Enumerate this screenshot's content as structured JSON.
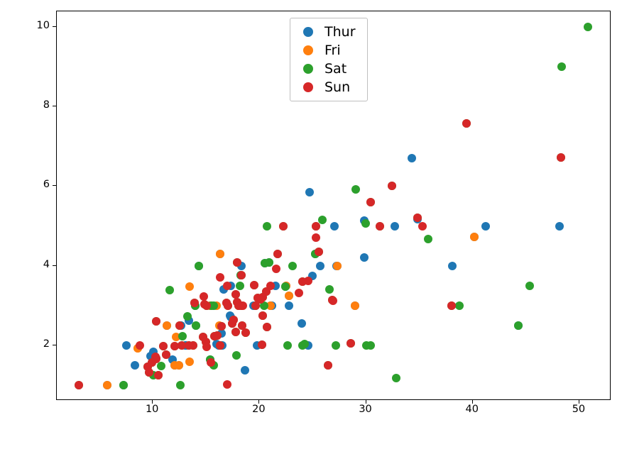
{
  "chart_data": {
    "type": "scatter",
    "title": "",
    "xlabel": "",
    "ylabel": "",
    "xlim": [
      1.0,
      53.0
    ],
    "ylim": [
      0.6,
      10.4
    ],
    "x_ticks": [
      10,
      20,
      30,
      40,
      50
    ],
    "y_ticks": [
      2,
      4,
      6,
      8,
      10
    ],
    "colors": {
      "Thur": "#1f77b4",
      "Fri": "#ff7f0e",
      "Sat": "#2ca02c",
      "Sun": "#d62728"
    },
    "legend": [
      "Thur",
      "Fri",
      "Sat",
      "Sun"
    ],
    "series": [
      {
        "name": "Thur",
        "points": [
          [
            27.2,
            4.0
          ],
          [
            22.76,
            3.0
          ],
          [
            17.29,
            2.71
          ],
          [
            19.44,
            3.0
          ],
          [
            16.66,
            3.4
          ],
          [
            10.07,
            1.83
          ],
          [
            32.68,
            5.0
          ],
          [
            15.98,
            2.03
          ],
          [
            34.83,
            5.17
          ],
          [
            13.03,
            2.0
          ],
          [
            18.28,
            4.0
          ],
          [
            24.71,
            5.85
          ],
          [
            21.16,
            3.0
          ],
          [
            28.97,
            3.0
          ],
          [
            22.49,
            3.5
          ],
          [
            5.75,
            1.0
          ],
          [
            16.32,
            4.3
          ],
          [
            22.75,
            3.25
          ],
          [
            40.17,
            4.73
          ],
          [
            27.28,
            4.0
          ],
          [
            12.03,
            1.5
          ],
          [
            21.01,
            3.0
          ],
          [
            12.46,
            1.5
          ],
          [
            11.35,
            2.5
          ],
          [
            15.38,
            3.0
          ],
          [
            44.3,
            2.5
          ],
          [
            22.42,
            3.48
          ],
          [
            20.92,
            4.08
          ],
          [
            15.36,
            1.64
          ],
          [
            20.49,
            4.06
          ],
          [
            25.21,
            4.29
          ],
          [
            18.24,
            3.76
          ],
          [
            14.31,
            4.0
          ],
          [
            14.0,
            3.0
          ],
          [
            7.25,
            1.0
          ],
          [
            38.07,
            4.0
          ],
          [
            23.95,
            2.55
          ],
          [
            25.71,
            4.0
          ],
          [
            17.31,
            3.5
          ],
          [
            29.8,
            4.2
          ],
          [
            34.3,
            6.7
          ],
          [
            41.19,
            5.0
          ],
          [
            27.05,
            5.0
          ],
          [
            16.43,
            2.3
          ],
          [
            8.35,
            1.5
          ],
          [
            18.64,
            1.36
          ],
          [
            11.87,
            1.63
          ],
          [
            9.78,
            1.73
          ],
          [
            7.51,
            2.0
          ],
          [
            14.07,
            2.5
          ],
          [
            13.13,
            2.0
          ],
          [
            17.26,
            2.74
          ],
          [
            24.55,
            2.0
          ],
          [
            19.77,
            2.0
          ],
          [
            29.85,
            5.14
          ],
          [
            48.17,
            5.0
          ],
          [
            25.0,
            3.75
          ],
          [
            13.39,
            2.61
          ],
          [
            16.49,
            2.0
          ],
          [
            21.5,
            3.5
          ],
          [
            12.66,
            2.5
          ],
          [
            16.21,
            2.0
          ]
        ]
      },
      {
        "name": "Fri",
        "points": [
          [
            28.97,
            3.0
          ],
          [
            22.49,
            3.5
          ],
          [
            5.75,
            1.0
          ],
          [
            16.32,
            4.3
          ],
          [
            22.75,
            3.25
          ],
          [
            40.17,
            4.73
          ],
          [
            27.28,
            4.0
          ],
          [
            12.03,
            1.5
          ],
          [
            21.01,
            3.0
          ],
          [
            12.46,
            1.5
          ],
          [
            11.35,
            2.5
          ],
          [
            15.38,
            3.0
          ],
          [
            8.58,
            1.92
          ],
          [
            13.42,
            1.58
          ],
          [
            12.16,
            2.2
          ],
          [
            13.42,
            3.48
          ],
          [
            8.58,
            1.92
          ],
          [
            15.98,
            3.0
          ],
          [
            16.27,
            2.5
          ]
        ]
      },
      {
        "name": "Sat",
        "points": [
          [
            20.65,
            3.35
          ],
          [
            17.92,
            4.08
          ],
          [
            20.29,
            2.75
          ],
          [
            15.77,
            2.23
          ],
          [
            39.42,
            7.58
          ],
          [
            19.82,
            3.18
          ],
          [
            17.81,
            2.34
          ],
          [
            13.37,
            2.0
          ],
          [
            12.69,
            2.0
          ],
          [
            21.7,
            4.3
          ],
          [
            19.65,
            3.0
          ],
          [
            9.55,
            1.45
          ],
          [
            18.35,
            2.5
          ],
          [
            15.06,
            3.0
          ],
          [
            20.69,
            2.45
          ],
          [
            17.78,
            3.27
          ],
          [
            24.06,
            3.6
          ],
          [
            16.31,
            2.0
          ],
          [
            16.93,
            3.07
          ],
          [
            18.69,
            2.31
          ],
          [
            31.27,
            5.0
          ],
          [
            16.04,
            2.24
          ],
          [
            17.46,
            2.54
          ],
          [
            13.94,
            3.06
          ],
          [
            9.68,
            1.32
          ],
          [
            30.4,
            5.6
          ],
          [
            18.29,
            3.0
          ],
          [
            22.23,
            5.0
          ],
          [
            32.4,
            6.0
          ],
          [
            28.55,
            2.05
          ],
          [
            18.04,
            3.0
          ],
          [
            12.54,
            2.5
          ],
          [
            10.29,
            2.6
          ],
          [
            34.81,
            5.2
          ],
          [
            9.94,
            1.56
          ],
          [
            25.56,
            4.34
          ],
          [
            19.49,
            3.51
          ],
          [
            38.01,
            3.0
          ],
          [
            26.41,
            1.5
          ],
          [
            11.24,
            1.76
          ],
          [
            48.27,
            6.73
          ],
          [
            20.29,
            3.21
          ],
          [
            13.81,
            2.0
          ],
          [
            11.02,
            1.98
          ],
          [
            18.29,
            3.76
          ],
          [
            17.59,
            2.64
          ],
          [
            20.08,
            3.15
          ],
          [
            16.45,
            2.47
          ],
          [
            3.07,
            1.0
          ],
          [
            20.23,
            2.01
          ],
          [
            15.01,
            2.09
          ],
          [
            12.02,
            1.97
          ],
          [
            17.07,
            3.0
          ],
          [
            26.86,
            3.14
          ],
          [
            25.28,
            5.0
          ],
          [
            14.73,
            2.2
          ],
          [
            10.51,
            1.25
          ],
          [
            17.92,
            3.08
          ],
          [
            44.3,
            2.5
          ],
          [
            22.42,
            3.48
          ],
          [
            20.92,
            4.08
          ],
          [
            15.36,
            1.64
          ],
          [
            20.49,
            4.06
          ],
          [
            25.21,
            4.29
          ],
          [
            18.24,
            3.76
          ],
          [
            14.31,
            4.0
          ],
          [
            14.0,
            3.0
          ],
          [
            7.25,
            1.0
          ],
          [
            48.33,
            9.0
          ],
          [
            20.45,
            3.0
          ],
          [
            13.28,
            2.72
          ],
          [
            24.01,
            2.0
          ],
          [
            15.69,
            3.0
          ],
          [
            11.61,
            3.39
          ],
          [
            10.77,
            1.47
          ],
          [
            15.53,
            3.0
          ],
          [
            10.07,
            1.25
          ],
          [
            12.6,
            1.0
          ],
          [
            32.83,
            1.17
          ],
          [
            35.83,
            4.67
          ],
          [
            29.03,
            5.92
          ],
          [
            27.18,
            2.0
          ],
          [
            22.67,
            2.0
          ],
          [
            17.82,
            1.75
          ],
          [
            50.81,
            10.0
          ],
          [
            45.35,
            3.5
          ],
          [
            20.69,
            5.0
          ],
          [
            30.46,
            2.0
          ],
          [
            18.15,
            3.5
          ],
          [
            23.1,
            4.0
          ],
          [
            15.69,
            1.5
          ],
          [
            26.59,
            3.41
          ],
          [
            38.73,
            3.0
          ],
          [
            24.27,
            2.03
          ],
          [
            12.76,
            2.23
          ],
          [
            30.06,
            2.0
          ],
          [
            25.89,
            5.16
          ],
          [
            29.93,
            5.07
          ],
          [
            14.07,
            2.5
          ]
        ]
      },
      {
        "name": "Sun",
        "points": [
          [
            16.99,
            1.01
          ],
          [
            10.34,
            1.66
          ],
          [
            21.01,
            3.5
          ],
          [
            23.68,
            3.31
          ],
          [
            24.59,
            3.61
          ],
          [
            25.29,
            4.71
          ],
          [
            8.77,
            2.0
          ],
          [
            26.88,
            3.12
          ],
          [
            15.04,
            1.96
          ],
          [
            14.78,
            3.23
          ],
          [
            10.27,
            1.71
          ],
          [
            35.26,
            5.0
          ],
          [
            15.42,
            1.57
          ],
          [
            18.43,
            3.0
          ],
          [
            14.83,
            3.02
          ],
          [
            21.58,
            3.92
          ],
          [
            10.33,
            1.67
          ],
          [
            16.29,
            3.71
          ],
          [
            16.97,
            3.5
          ],
          [
            20.65,
            3.35
          ],
          [
            17.92,
            4.08
          ],
          [
            20.29,
            2.75
          ],
          [
            15.77,
            2.23
          ],
          [
            39.42,
            7.58
          ],
          [
            19.82,
            3.18
          ],
          [
            17.81,
            2.34
          ],
          [
            13.37,
            2.0
          ],
          [
            12.69,
            2.0
          ],
          [
            21.7,
            4.3
          ],
          [
            19.65,
            3.0
          ],
          [
            9.55,
            1.45
          ],
          [
            18.35,
            2.5
          ],
          [
            15.06,
            3.0
          ],
          [
            20.69,
            2.45
          ],
          [
            17.78,
            3.27
          ],
          [
            24.06,
            3.6
          ],
          [
            16.31,
            2.0
          ],
          [
            16.93,
            3.07
          ],
          [
            18.69,
            2.31
          ],
          [
            31.27,
            5.0
          ],
          [
            16.04,
            2.24
          ],
          [
            17.46,
            2.54
          ],
          [
            13.94,
            3.06
          ],
          [
            9.68,
            1.32
          ],
          [
            30.4,
            5.6
          ],
          [
            18.29,
            3.0
          ],
          [
            22.23,
            5.0
          ],
          [
            32.4,
            6.0
          ],
          [
            28.55,
            2.05
          ],
          [
            18.04,
            3.0
          ],
          [
            12.54,
            2.5
          ],
          [
            10.29,
            2.6
          ],
          [
            34.81,
            5.2
          ],
          [
            9.94,
            1.56
          ],
          [
            25.56,
            4.34
          ],
          [
            19.49,
            3.51
          ],
          [
            38.01,
            3.0
          ],
          [
            26.41,
            1.5
          ],
          [
            11.24,
            1.76
          ],
          [
            48.27,
            6.73
          ],
          [
            20.29,
            3.21
          ],
          [
            13.81,
            2.0
          ],
          [
            11.02,
            1.98
          ],
          [
            18.29,
            3.76
          ],
          [
            17.59,
            2.64
          ],
          [
            20.08,
            3.15
          ],
          [
            16.45,
            2.47
          ],
          [
            3.07,
            1.0
          ],
          [
            20.23,
            2.01
          ],
          [
            15.01,
            2.09
          ],
          [
            12.02,
            1.97
          ],
          [
            17.07,
            3.0
          ],
          [
            26.86,
            3.14
          ],
          [
            25.28,
            5.0
          ],
          [
            14.73,
            2.2
          ],
          [
            10.51,
            1.25
          ],
          [
            17.92,
            3.08
          ]
        ]
      }
    ]
  }
}
